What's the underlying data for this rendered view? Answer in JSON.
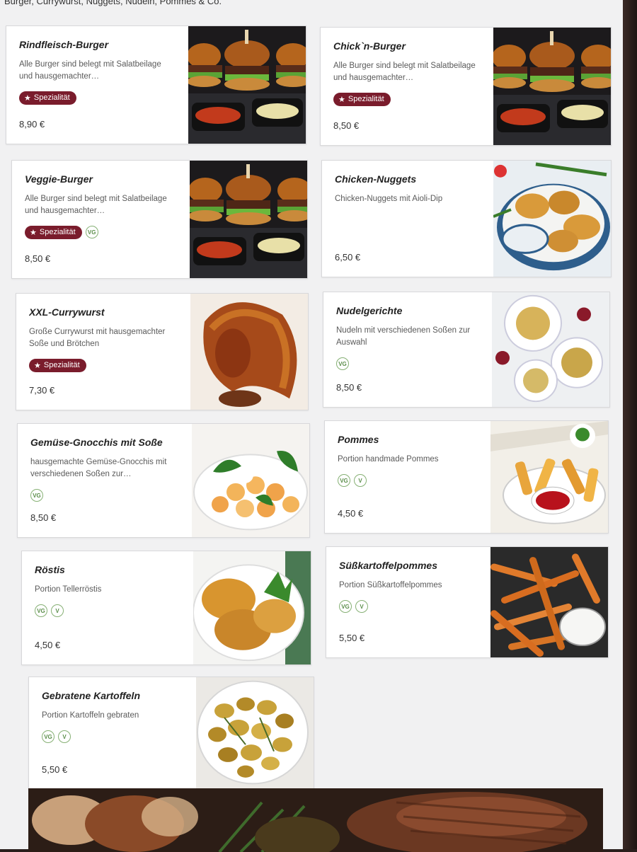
{
  "category_header": "Burger, Currywurst, Nuggets, Nudeln, Pommes & Co.",
  "dishes": [
    {
      "name": "Rindfleisch-Burger",
      "description": "Alle Burger sind belegt mit Salatbeilage und hausgemachter…",
      "badge": "Spezialität",
      "diet": [],
      "price": "8,90 €",
      "image": "burger-photo"
    },
    {
      "name": "Chick`n-Burger",
      "description": "Alle Burger sind belegt mit Salatbeilage und hausgemachter…",
      "badge": "Spezialität",
      "diet": [],
      "price": "8,50 €",
      "image": "burger-photo"
    },
    {
      "name": "Veggie-Burger",
      "description": "Alle Burger sind belegt mit Salatbeilage und hausgemachter…",
      "badge": "Spezialität",
      "diet": [
        "VG"
      ],
      "price": "8,50 €",
      "image": "burger-photo"
    },
    {
      "name": "Chicken-Nuggets",
      "description": "Chicken-Nuggets mit Aioli-Dip",
      "badge": "",
      "diet": [],
      "price": "6,50 €",
      "image": "nuggets-photo"
    },
    {
      "name": "XXL-Currywurst",
      "description": "Große Currywurst mit hausgemachter Soße und Brötchen",
      "badge": "Spezialität",
      "diet": [],
      "price": "7,30 €",
      "image": "currywurst-photo"
    },
    {
      "name": "Nudelgerichte",
      "description": "Nudeln mit verschiedenen Soßen zur Auswahl",
      "badge": "",
      "diet": [
        "VG"
      ],
      "price": "8,50 €",
      "image": "pasta-photo"
    },
    {
      "name": "Gemüse-Gnocchis mit Soße",
      "description": "hausgemachte Gemüse-Gnocchis mit verschiedenen Soßen zur…",
      "badge": "",
      "diet": [
        "VG"
      ],
      "price": "8,50 €",
      "image": "gnocchi-photo"
    },
    {
      "name": "Pommes",
      "description": "Portion handmade Pommes",
      "badge": "",
      "diet": [
        "VG",
        "V"
      ],
      "price": "4,50 €",
      "image": "fries-photo"
    },
    {
      "name": "Röstis",
      "description": "Portion Tellerröstis",
      "badge": "",
      "diet": [
        "VG",
        "V"
      ],
      "price": "4,50 €",
      "image": "roesti-photo"
    },
    {
      "name": "Süßkartoffelpommes",
      "description": "Portion Süßkartoffelpommes",
      "badge": "",
      "diet": [
        "VG",
        "V"
      ],
      "price": "5,50 €",
      "image": "sweet-potato-fries-photo"
    },
    {
      "name": "Gebratene Kartoffeln",
      "description": "Portion Kartoffeln gebraten",
      "badge": "",
      "diet": [
        "VG",
        "V"
      ],
      "price": "5,50 €",
      "image": "roast-potatoes-photo"
    }
  ],
  "colors": {
    "badge": "#7a1c2c",
    "diet_icon": "#86b074",
    "background": "#f1f1f2",
    "card": "#ffffff"
  }
}
